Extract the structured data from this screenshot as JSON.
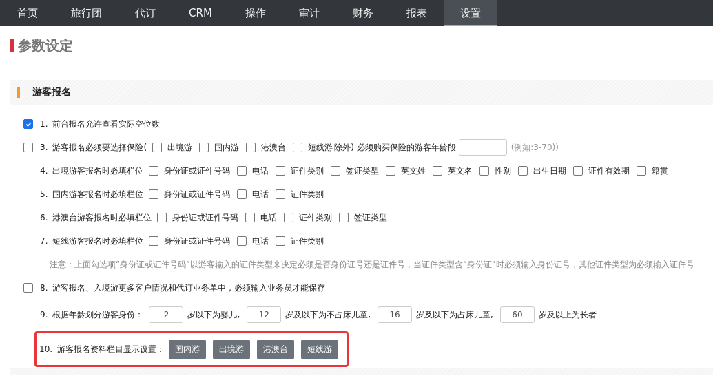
{
  "nav": [
    {
      "label": "首页",
      "selected": false
    },
    {
      "label": "旅行团",
      "selected": false
    },
    {
      "label": "代订",
      "selected": false
    },
    {
      "label": "CRM",
      "selected": false
    },
    {
      "label": "操作",
      "selected": false
    },
    {
      "label": "审计",
      "selected": false
    },
    {
      "label": "财务",
      "selected": false
    },
    {
      "label": "报表",
      "selected": false
    },
    {
      "label": "设置",
      "selected": true
    }
  ],
  "page_title": "参数设定",
  "section": {
    "title": "游客报名"
  },
  "rows": [
    {
      "kind": "toggle",
      "checked": true,
      "number": "1.",
      "label": "前台报名允许查看实际空位数"
    },
    {
      "kind": "insurance",
      "checked": false,
      "number": "3.",
      "label": "游客报名必须要选择保险(",
      "options": [
        {
          "label": "出境游",
          "checked": false
        },
        {
          "label": "国内游",
          "checked": false
        },
        {
          "label": "港澳台",
          "checked": false
        },
        {
          "label": "短线游",
          "checked": false
        }
      ],
      "suffix": "除外) 必须购买保险的游客年龄段",
      "hint": "(例如:3-70))"
    },
    {
      "kind": "fields",
      "number": "4.",
      "label": "出境游客报名时必填栏位",
      "options": [
        {
          "label": "身份证或证件号码",
          "checked": false
        },
        {
          "label": "电话",
          "checked": false
        },
        {
          "label": "证件类别",
          "checked": false
        },
        {
          "label": "签证类型",
          "checked": false
        },
        {
          "label": "英文姓",
          "checked": false
        },
        {
          "label": "英文名",
          "checked": false
        },
        {
          "label": "性别",
          "checked": false
        },
        {
          "label": "出生日期",
          "checked": false
        },
        {
          "label": "证件有效期",
          "checked": false
        },
        {
          "label": "籍贯",
          "checked": false
        }
      ]
    },
    {
      "kind": "fields",
      "number": "5.",
      "label": "国内游客报名时必填栏位",
      "options": [
        {
          "label": "身份证或证件号码",
          "checked": false
        },
        {
          "label": "电话",
          "checked": false
        },
        {
          "label": "证件类别",
          "checked": false
        }
      ]
    },
    {
      "kind": "fields",
      "number": "6.",
      "label": "港澳台游客报名时必填栏位",
      "options": [
        {
          "label": "身份证或证件号码",
          "checked": false
        },
        {
          "label": "电话",
          "checked": false
        },
        {
          "label": "证件类别",
          "checked": false
        },
        {
          "label": "签证类型",
          "checked": false
        }
      ]
    },
    {
      "kind": "fields",
      "number": "7.",
      "label": "短线游客报名时必填栏位",
      "options": [
        {
          "label": "身份证或证件号码",
          "checked": false
        },
        {
          "label": "电话",
          "checked": false
        },
        {
          "label": "证件类别",
          "checked": false
        }
      ]
    },
    {
      "kind": "note",
      "text": "注意：上面勾选项“身份证或证件号码”以游客输入的证件类型来决定必须是否身份证号还是证件号，当证件类型含“身份证”时必须输入身份证号，其他证件类型为必须输入证件号"
    },
    {
      "kind": "toggle",
      "checked": false,
      "number": "8.",
      "label": "游客报名、入境游更多客户情况和代订业务单中，必须输入业务员才能保存"
    },
    {
      "kind": "ages",
      "number": "9.",
      "label": "根据年龄划分游客身份：",
      "parts": [
        {
          "value": "2",
          "text": "岁以下为婴儿,"
        },
        {
          "value": "12",
          "text": "岁及以下为不占床儿童,"
        },
        {
          "value": "16",
          "text": "岁及以下为占床儿童,"
        },
        {
          "value": "60",
          "text": "岁及以上为长者"
        }
      ]
    },
    {
      "kind": "buttons",
      "highlighted": true,
      "number": "10.",
      "label": "游客报名资料栏目显示设置：",
      "buttons": [
        "国内游",
        "出境游",
        "港澳台",
        "短线游"
      ]
    }
  ]
}
